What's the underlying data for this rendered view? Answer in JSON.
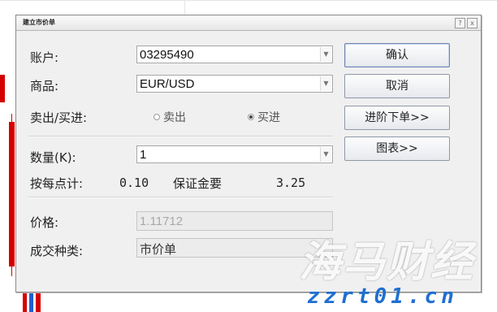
{
  "dialog": {
    "title": "建立市价单",
    "help_btn": "?",
    "close_btn": "x"
  },
  "form": {
    "account_label": "账户:",
    "account_value": "03295490",
    "symbol_label": "商品:",
    "symbol_value": "EUR/USD",
    "direction_label": "卖出/买进:",
    "sell_option": "卖出",
    "buy_option": "买进",
    "selected_direction": "买进",
    "quantity_label": "数量(K):",
    "quantity_value": "1",
    "pip_value_label": "按每点计:",
    "pip_value": "0.10",
    "margin_label": "保证金要",
    "margin_value": "3.25",
    "price_label": "价格:",
    "price_value": "1.11712",
    "order_type_label": "成交种类:",
    "order_type_value": "市价单"
  },
  "buttons": {
    "confirm": "确认",
    "cancel": "取消",
    "advanced": "进阶下单>>",
    "chart": "图表>>"
  },
  "watermark": {
    "text_cn": "海马财经",
    "text_url": "zzrt01.cn"
  },
  "colors": {
    "candle_red": "#d40000",
    "candle_blue": "#1f5fd1",
    "watermark_blue": "#1f6fd1"
  }
}
